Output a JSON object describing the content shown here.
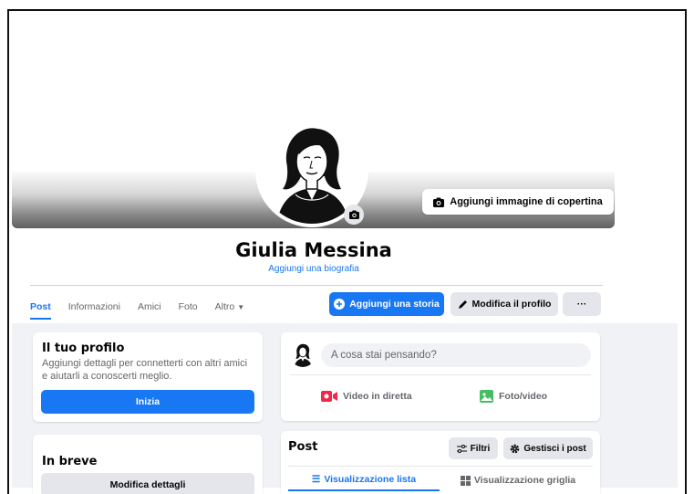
{
  "profile": {
    "name": "Giulia Messina",
    "bio_link": "Aggiungi una biografia",
    "cover_button": "Aggiungi immagine di copertina"
  },
  "tabs": [
    {
      "label": "Post",
      "active": true
    },
    {
      "label": "Informazioni",
      "active": false
    },
    {
      "label": "Amici",
      "active": false
    },
    {
      "label": "Foto",
      "active": false
    },
    {
      "label": "Altro",
      "active": false
    }
  ],
  "actions": {
    "add_story": "Aggiungi una storia",
    "edit_profile": "Modifica il profilo",
    "more": "···"
  },
  "your_profile": {
    "title": "Il tuo profilo",
    "description": "Aggiungi dettagli per connetterti con altri amici e aiutarli a conoscerti meglio.",
    "button": "Inizia"
  },
  "brief": {
    "title": "In breve",
    "button": "Modifica dettagli"
  },
  "composer": {
    "placeholder": "A cosa stai pensando?",
    "live_video": "Video in diretta",
    "photo_video": "Foto/video"
  },
  "posts": {
    "title": "Post",
    "filters": "Filtri",
    "manage": "Gestisci i post",
    "list_view": "Visualizzazione lista",
    "grid_view": "Visualizzazione griglia"
  },
  "colors": {
    "accent": "#1877f2",
    "live_red": "#f02849",
    "photo_green": "#45bd62"
  }
}
